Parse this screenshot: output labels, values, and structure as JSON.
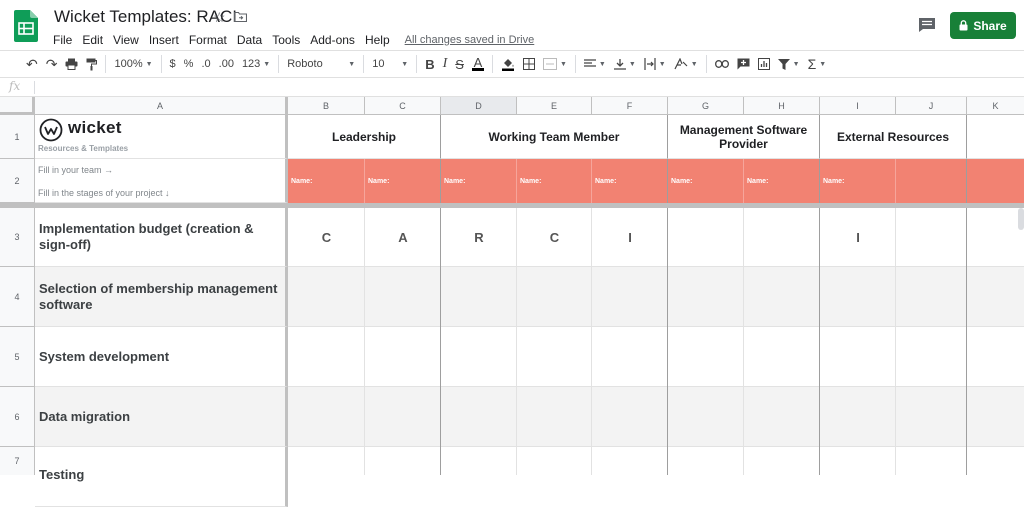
{
  "app": {
    "doc_title": "Wicket Templates: RACI",
    "saved_status": "All changes saved in Drive",
    "share_label": "Share",
    "menu": [
      "File",
      "Edit",
      "View",
      "Insert",
      "Format",
      "Data",
      "Tools",
      "Add-ons",
      "Help"
    ]
  },
  "toolbar": {
    "zoom": "100%",
    "currency": "$",
    "percent": "%",
    "decimal_less": ".0",
    "decimal_more": ".00",
    "more_formats": "123",
    "font": "Roboto",
    "font_size": "10"
  },
  "formula_bar": {
    "fx": "fx",
    "value": ""
  },
  "columns": [
    "A",
    "B",
    "C",
    "D",
    "E",
    "F",
    "G",
    "H",
    "I",
    "J",
    "K"
  ],
  "rows": [
    "1",
    "2",
    "3",
    "4",
    "5",
    "6",
    "7"
  ],
  "header": {
    "brand": "wicket",
    "brand_sub": "Resources & Templates",
    "hint_team": "Fill in your team →",
    "hint_stages": "Fill in the stages of your project ↓",
    "groups": [
      "Leadership",
      "Working Team Member",
      "Management Software Provider",
      "External Resources"
    ],
    "name_label": "Name:"
  },
  "tasks": [
    {
      "label": "Implementation budget (creation & sign-off)",
      "raci": [
        "C",
        "A",
        "R",
        "C",
        "I",
        "",
        "",
        "I",
        ""
      ]
    },
    {
      "label": "Selection of membership management software",
      "raci": [
        "",
        "",
        "",
        "",
        "",
        "",
        "",
        "",
        ""
      ]
    },
    {
      "label": "System development",
      "raci": [
        "",
        "",
        "",
        "",
        "",
        "",
        "",
        "",
        ""
      ]
    },
    {
      "label": "Data migration",
      "raci": [
        "",
        "",
        "",
        "",
        "",
        "",
        "",
        "",
        ""
      ]
    },
    {
      "label": "Testing",
      "raci": [
        "",
        "",
        "",
        "",
        "",
        "",
        "",
        "",
        ""
      ]
    }
  ],
  "colors": {
    "accent_share": "#188038",
    "name_row": "#f28272",
    "stripe": "#f3f3f3"
  }
}
